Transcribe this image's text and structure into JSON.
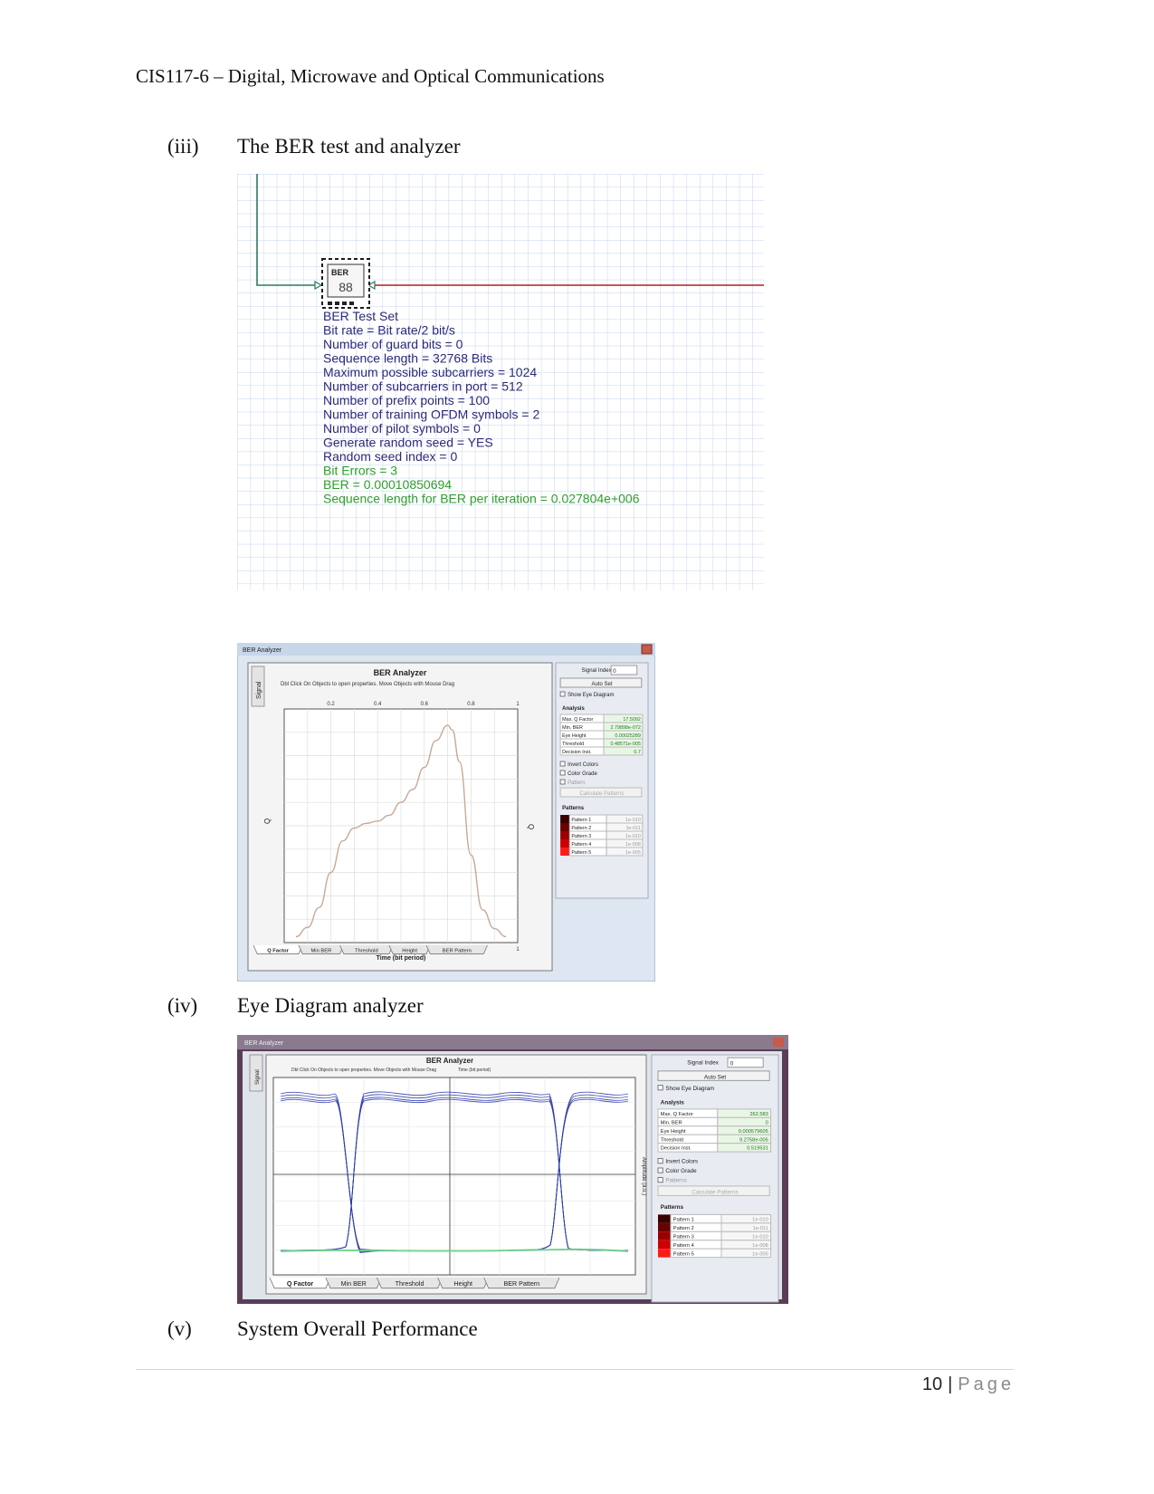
{
  "header": {
    "title": "CIS117-6 – Digital, Microwave and Optical Communications"
  },
  "sections": [
    {
      "num": "(iii)",
      "title": "The BER test and analyzer"
    },
    {
      "num": "(iv)",
      "title": "Eye Diagram analyzer"
    },
    {
      "num": "(v)",
      "title": "System Overall Performance"
    }
  ],
  "ber_component": {
    "icon_text": "BER",
    "icon_digits": "88",
    "param_lines": [
      "BER Test Set",
      "Bit rate = Bit rate/2  bit/s",
      "Number of guard bits = 0",
      "Sequence length = 32768  Bits",
      "Maximum possible subcarriers = 1024",
      "Number of subcarriers in port = 512",
      "Number of prefix points = 100",
      "Number of training OFDM symbols = 2",
      "Number of pilot symbols = 0",
      "Generate random seed = YES",
      "Random seed index = 0"
    ],
    "result_lines": [
      "Bit Errors = 3",
      "BER = 0.00010850694",
      "Sequence length for BER per iteration = 0.027804e+006"
    ],
    "colors": {
      "params": "#2a2a7a",
      "results": "#2e9e2e",
      "wire_in": "#2d7a5a",
      "wire_out": "#b02020",
      "grid": "#c4d4ee"
    }
  },
  "analyzer_q": {
    "window_title": "BER Analyzer",
    "chart_title": "BER Analyzer",
    "chart_subtitle": "Dbl Click On Objects to open properties.  Move Objects with Mouse Drag",
    "side_tab": "Signal",
    "signal_index_label": "Signal Index",
    "signal_index_value": "0",
    "auto_set": "Auto Set",
    "show_eye": "Show Eye Diagram",
    "analysis_label": "Analysis",
    "analysis_rows": [
      {
        "k": "Max. Q Factor",
        "v": "17.5092"
      },
      {
        "k": "Min. BER",
        "v": "2.79898e-072"
      },
      {
        "k": "Eye Height",
        "v": "0.00025289"
      },
      {
        "k": "Threshold",
        "v": "0.48571e-005"
      },
      {
        "k": "Decision Inst.",
        "v": "0.7"
      }
    ],
    "invert_colors": "Invert Colors",
    "color_grade": "Color Grade",
    "patterns_check": "Pattern",
    "calc_patterns": "Calculate Patterns",
    "patterns_label": "Patterns",
    "pattern_rows": [
      {
        "k": "Pattern 1",
        "v": "1e-010"
      },
      {
        "k": "Pattern 2",
        "v": "1e-011"
      },
      {
        "k": "Pattern 3",
        "v": "1e-010"
      },
      {
        "k": "Pattern 4",
        "v": "1e-008"
      },
      {
        "k": "Pattern 5",
        "v": "1e-005"
      }
    ],
    "pattern_colors": [
      "#3a0000",
      "#6a0000",
      "#9a0000",
      "#cc0000",
      "#ff1a1a"
    ],
    "tabs": [
      "Q Factor",
      "Min BER",
      "Threshold",
      "Height",
      "BER Pattern"
    ],
    "chart_data": {
      "type": "line",
      "xlabel": "Time (bit period)",
      "ylabel": "Q",
      "xticks": [
        "0.2",
        "0.4",
        "0.6",
        "0.8",
        "1"
      ],
      "xlim": [
        0,
        1
      ],
      "ylim": [
        0,
        20
      ],
      "series": [
        {
          "x": [
            0.05,
            0.1,
            0.15,
            0.2,
            0.25,
            0.3,
            0.35,
            0.4,
            0.45,
            0.5,
            0.55,
            0.6,
            0.65,
            0.7,
            0.72,
            0.75,
            0.8,
            0.85,
            0.9,
            0.95
          ],
          "values": [
            0.5,
            1.3,
            3.0,
            6.0,
            8.7,
            9.8,
            10.2,
            10.4,
            10.9,
            12.0,
            13.1,
            15.0,
            17.3,
            18.6,
            18.2,
            15.5,
            7.5,
            2.8,
            1.2,
            0.5
          ]
        }
      ],
      "line_color": "#c8a898"
    }
  },
  "analyzer_eye": {
    "window_title": "BER Analyzer",
    "chart_title": "BER Analyzer",
    "chart_subtitle": "Dbl Click On Objects to open properties.  Move Objects with Mouse Drag",
    "x_axis_top": "Time (bit period)",
    "y_axis_right": "Amplitude (a.u.)",
    "side_tab": "Signal",
    "signal_index_label": "Signal Index",
    "signal_index_value": "0",
    "auto_set": "Auto Set",
    "show_eye": "Show Eye Diagram",
    "analysis_label": "Analysis",
    "analysis_rows": [
      {
        "k": "Max. Q Factor",
        "v": "262.583"
      },
      {
        "k": "Min. BER",
        "v": "0"
      },
      {
        "k": "Eye Height",
        "v": "0.000579605"
      },
      {
        "k": "Threshold",
        "v": "9.2758e-005"
      },
      {
        "k": "Decision Inst.",
        "v": "0.519531"
      }
    ],
    "invert_colors": "Invert Colors",
    "color_grade": "Color Grade",
    "patterns_check": "Patterns",
    "calc_patterns": "Calculate Patterns",
    "patterns_label": "Patterns",
    "pattern_rows": [
      {
        "k": "Pattern 1",
        "v": "1e-010"
      },
      {
        "k": "Pattern 2",
        "v": "1e-011"
      },
      {
        "k": "Pattern 3",
        "v": "1e-010"
      },
      {
        "k": "Pattern 4",
        "v": "1e-008"
      },
      {
        "k": "Pattern 5",
        "v": "1e-005"
      }
    ],
    "pattern_colors": [
      "#3a0000",
      "#6a0000",
      "#9a0000",
      "#cc0000",
      "#ff1a1a"
    ],
    "tabs": [
      "Q Factor",
      "Min BER",
      "Threshold",
      "Height",
      "BER Pattern"
    ],
    "colors": {
      "eye": "#2a3aa8",
      "base": "#6ad08a"
    }
  },
  "footer": {
    "page": "10",
    "sep": "|",
    "word": "Page"
  }
}
